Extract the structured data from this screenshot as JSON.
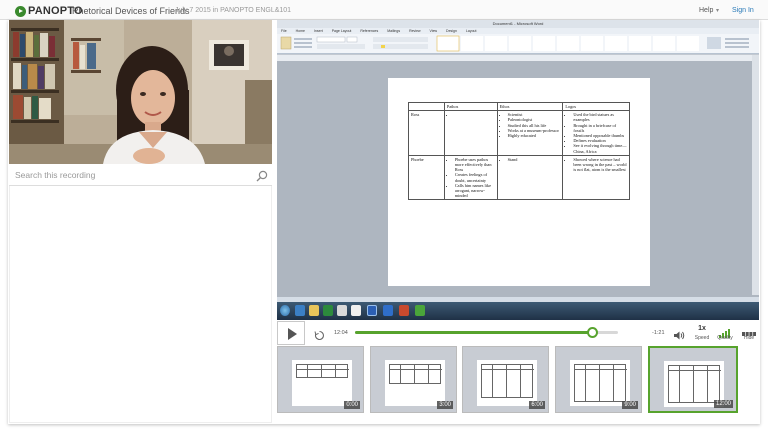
{
  "header": {
    "logo_text": "PANOPTO",
    "title": "Rhetorical Devices of Friends",
    "subtitle": "July 7 2015 in PANOPTO ENGL&101",
    "help_label": "Help",
    "signin_label": "Sign In"
  },
  "search": {
    "placeholder": "Search this recording"
  },
  "screen": {
    "window_title": "Document1 - Microsoft Word",
    "ribbon_tabs": [
      "File",
      "Home",
      "Insert",
      "Page Layout",
      "References",
      "Mailings",
      "Review",
      "View",
      "Design",
      "Layout"
    ],
    "table": {
      "headers": [
        "",
        "Pathos",
        "Ethos",
        "Logos"
      ],
      "rows": [
        {
          "name": "Ross",
          "pathos": [
            ""
          ],
          "ethos": [
            "Scientist",
            "Paleontologist",
            "Studied this all his life",
            "Works at a museum-professor",
            "Highly educated"
          ],
          "logos": [
            "Used the bird statues as examples",
            "Brought in a briefcase of fossils",
            "Mentioned opposable thumbs",
            "Defines evaluation",
            "See it evolving through time—China, Africa"
          ]
        },
        {
          "name": "Phoebe",
          "pathos": [
            "Phoebe uses pathos more effectively than Ross",
            "Creates feelings of doubt, uncertainty",
            "Calls him names like arrogant, narrow-minded"
          ],
          "ethos": [
            "Stand"
          ],
          "logos": [
            "Showed where science had been wrong in the past – world is not flat, atom is the smallest"
          ]
        }
      ]
    }
  },
  "player": {
    "current_time": "12:04",
    "remaining_time": "-1:21",
    "progress": 0.9,
    "speed_value": "1x",
    "speed_label": "Speed",
    "quality_label": "Quality",
    "hide_label": "Hide",
    "accent_color": "#57a32d"
  },
  "thumbnails": [
    {
      "time": "0:00"
    },
    {
      "time": "3:00"
    },
    {
      "time": "6:00"
    },
    {
      "time": "9:00"
    },
    {
      "time": "12:00"
    }
  ]
}
